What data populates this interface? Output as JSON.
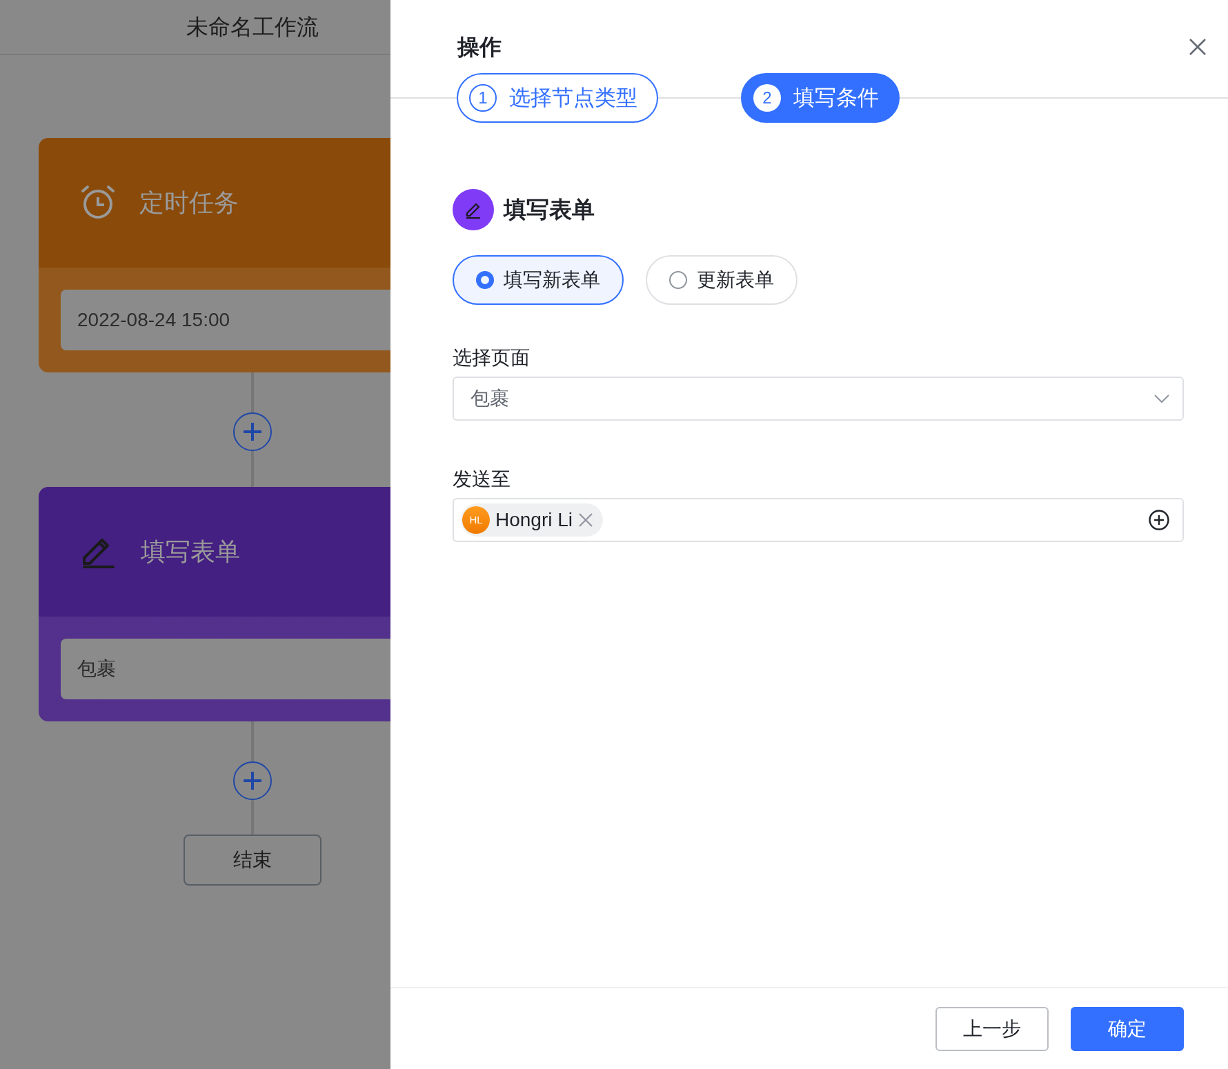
{
  "canvas": {
    "title": "未命名工作流",
    "nodes": [
      {
        "kind": "trigger",
        "title": "定时任务",
        "value": "2022-08-24 15:00",
        "color": "#8a4a0a"
      },
      {
        "kind": "form",
        "title": "填写表单",
        "value": "包裹",
        "color": "#442082"
      }
    ],
    "end_label": "结束"
  },
  "drawer": {
    "title": "操作",
    "steps": [
      {
        "number": "1",
        "label": "选择节点类型",
        "selected": false
      },
      {
        "number": "2",
        "label": "填写条件",
        "selected": true
      }
    ],
    "section_title": "填写表单",
    "modes": [
      {
        "label": "填写新表单",
        "selected": true
      },
      {
        "label": "更新表单",
        "selected": false
      }
    ],
    "fields": [
      {
        "kind": "select",
        "label": "选择页面",
        "value": "包裹"
      },
      {
        "kind": "people",
        "label": "发送至",
        "people": [
          {
            "initials": "HL",
            "name": "Hongri Li"
          }
        ]
      }
    ],
    "buttons": [
      {
        "kind": "secondary",
        "label": "上一步"
      },
      {
        "kind": "primary",
        "label": "确定"
      }
    ]
  }
}
